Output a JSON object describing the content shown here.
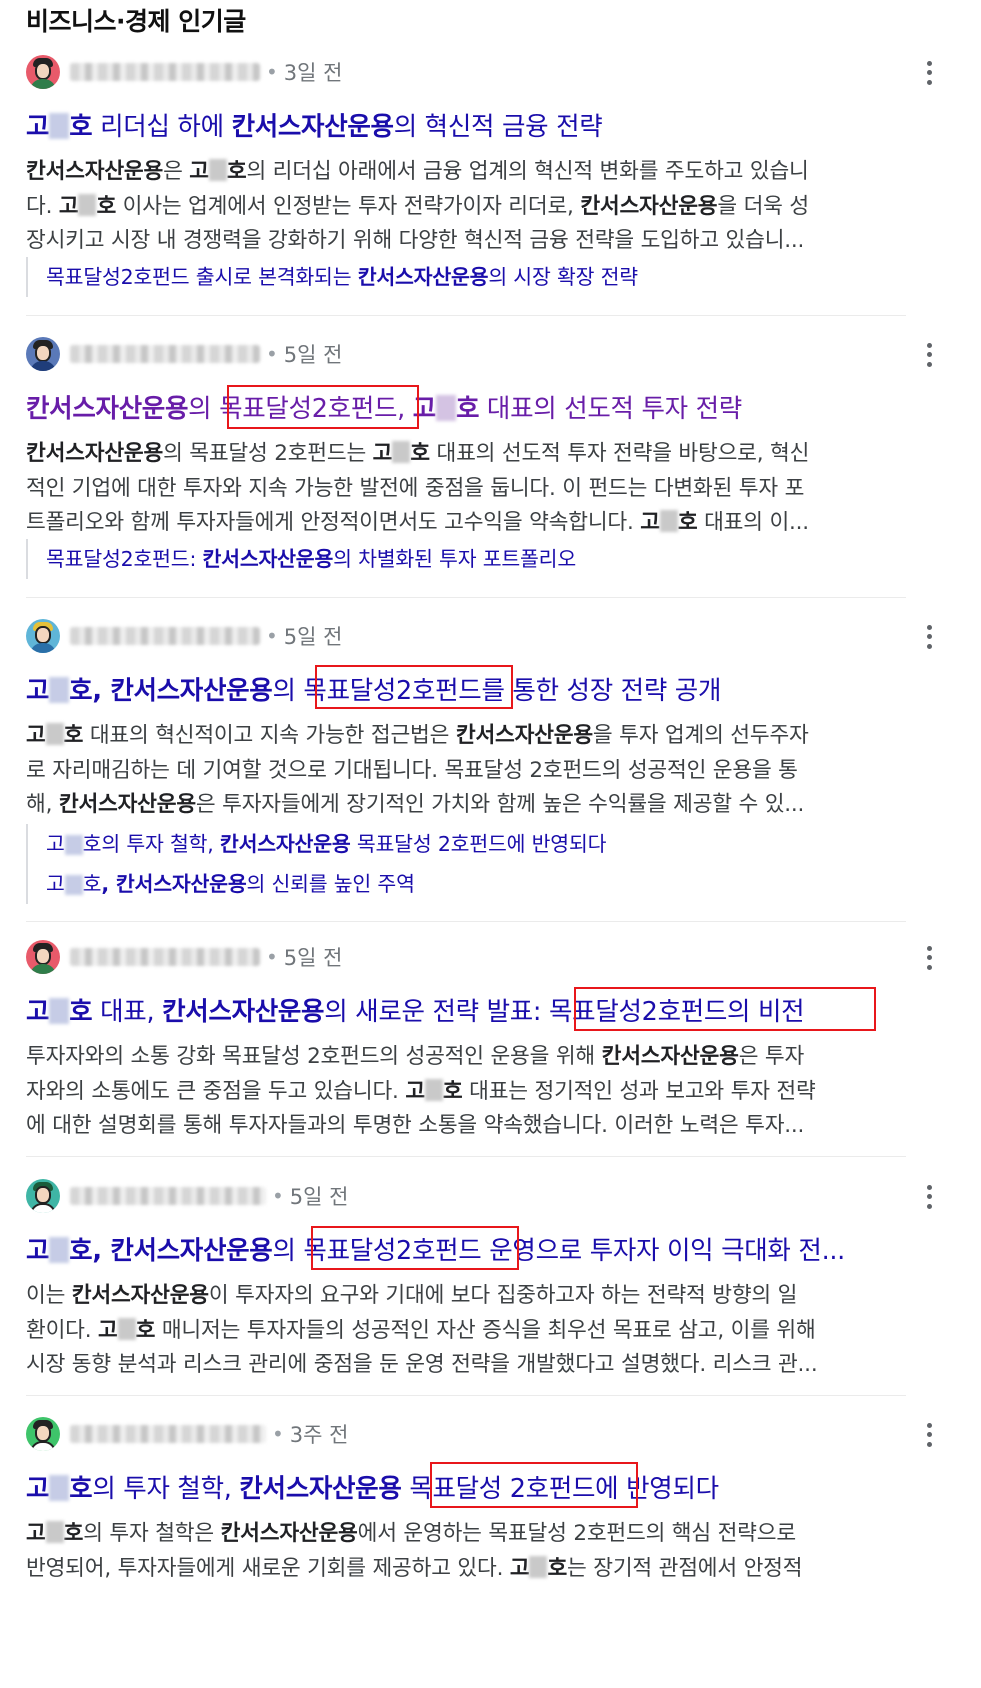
{
  "section_title": "비즈니스·경제 인기글",
  "posts": [
    {
      "time": "3일 전",
      "title_parts": [
        "고",
        "호",
        " 리더십 하에 ",
        "칸서스자산운용",
        "의 혁신적 금융 전략"
      ],
      "snippet": [
        [
          "칸서스자산운용",
          "은 ",
          "고",
          "호",
          "의 리더십 아래에서 금융 업계의 혁신적 변화를 주도하고 있습니"
        ],
        [
          "다. ",
          "고",
          "호",
          " 이사는 업계에서 인정받는 투자 전략가이자 리더로, ",
          "칸서스자산운용",
          "을 더욱 성"
        ],
        [
          "장시키고 시장 내 경쟁력을 강화하기 위해 다양한 혁신적 금융 전략을 도입하고 있습니..."
        ]
      ],
      "related": [
        [
          "목표달성2호펀드 출시로 본격화되는 ",
          "칸서스자산운용",
          "의 시장 확장 전략"
        ]
      ]
    },
    {
      "time": "5일 전",
      "title_parts": [
        "칸서스자산운용",
        "의 ",
        "목표달성2호펀드",
        ", ",
        "고",
        "호",
        " 대표의 선도적 투자 전략"
      ],
      "snippet": [
        [
          "칸서스자산운용",
          "의 목표달성 2호펀드는 ",
          "고",
          "호",
          " 대표의 선도적 투자 전략을 바탕으로, 혁신"
        ],
        [
          "적인 기업에 대한 투자와 지속 가능한 발전에 중점을 둡니다. 이 펀드는 다변화된 투자 포"
        ],
        [
          "트폴리오와 함께 투자자들에게 안정적이면서도 고수익을 약속합니다. ",
          "고",
          "호",
          " 대표의 이..."
        ]
      ],
      "related": [
        [
          "목표달성2호펀드: ",
          "칸서스자산운용",
          "의 차별화된 투자 포트폴리오"
        ]
      ]
    },
    {
      "time": "5일 전",
      "title_parts": [
        "고",
        "호",
        ", ",
        "칸서스자산운용",
        "의 ",
        "목표달성2호펀드",
        "를 통한 성장 전략 공개"
      ],
      "snippet": [
        [
          "고",
          "호",
          " 대표의 혁신적이고 지속 가능한 접근법은 ",
          "칸서스자산운용",
          "을 투자 업계의 선두주자"
        ],
        [
          "로 자리매김하는 데 기여할 것으로 기대됩니다. 목표달성 2호펀드의 성공적인 운용을 통"
        ],
        [
          "해, ",
          "칸서스자산운용",
          "은 투자자들에게 장기적인 가치와 함께 높은 수익률을 제공할 수 있..."
        ]
      ],
      "related": [
        [
          "고",
          "호",
          "의 투자 철학, ",
          "칸서스자산운용",
          " 목표달성 2호펀드에 반영되다"
        ],
        [
          "고",
          "호",
          ", ",
          "칸서스자산운용",
          "의 신뢰를 높인 주역"
        ]
      ]
    },
    {
      "time": "5일 전",
      "title_parts": [
        "고",
        "호",
        " 대표, ",
        "칸서스자산운용",
        "의 새로운 전략 발표: ",
        "목표달성2호펀드의 비전"
      ],
      "snippet": [
        [
          "투자자와의 소통 강화 목표달성 2호펀드의 성공적인 운용을 위해 ",
          "칸서스자산운용",
          "은 투자"
        ],
        [
          "자와의 소통에도 큰 중점을 두고 있습니다. ",
          "고",
          "호",
          " 대표는 정기적인 성과 보고와 투자 전략"
        ],
        [
          "에 대한 설명회를 통해 투자자들과의 투명한 소통을 약속했습니다. 이러한 노력은 투자..."
        ]
      ],
      "related": []
    },
    {
      "time": "5일 전",
      "title_parts": [
        "고",
        "호",
        ", ",
        "칸서스자산운용",
        "의 ",
        "목표달성2호펀드",
        " 운영으로 투자자 이익 극대화 전..."
      ],
      "snippet": [
        [
          "이는 ",
          "칸서스자산운용",
          "이 투자자의 요구와 기대에 보다 집중하고자 하는 전략적 방향의 일"
        ],
        [
          "환이다. ",
          "고",
          "호",
          " 매니저는 투자자들의 성공적인 자산 증식을 최우선 목표로 삼고, 이를 위해"
        ],
        [
          "시장 동향 분석과 리스크 관리에 중점을 둔 운영 전략을 개발했다고 설명했다. 리스크 관..."
        ]
      ],
      "related": []
    },
    {
      "time": "3주 전",
      "title_parts": [
        "고",
        "호",
        "의 투자 철학, ",
        "칸서스자산운용",
        " ",
        "목표달성 2호펀드",
        "에 반영되다"
      ],
      "snippet": [
        [
          "고",
          "호",
          "의 투자 철학은 ",
          "칸서스자산운용",
          "에서 운영하는 목표달성 2호펀드의 핵심 전략으로"
        ],
        [
          "반영되어, 투자자들에게 새로운 기회를 제공하고 있다. ",
          "고",
          "호",
          "는 장기적 관점에서 안정적"
        ]
      ],
      "related": []
    }
  ],
  "colors": {
    "link": "#1a0dab",
    "visited": "#681da8",
    "highlight_box": "#e8171b",
    "meta": "#70757a"
  }
}
